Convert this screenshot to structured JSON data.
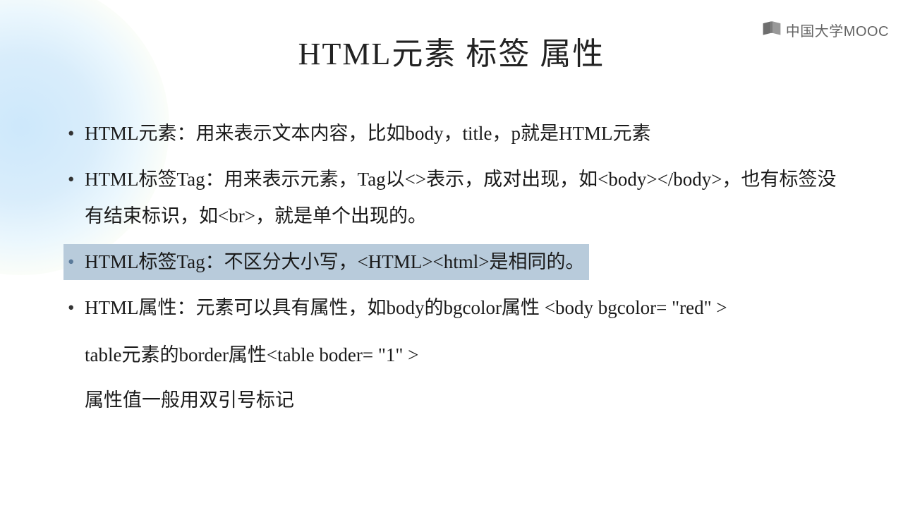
{
  "watermark": {
    "text": "中国大学MOOC"
  },
  "slide": {
    "title": "HTML元素 标签 属性",
    "bullets": [
      {
        "text": "HTML元素：用来表示文本内容，比如body，title，p就是HTML元素",
        "highlighted": false
      },
      {
        "text": "HTML标签Tag：用来表示元素，Tag以<>表示，成对出现，如<body></body>，也有标签没有结束标识，如<br>，就是单个出现的。",
        "highlighted": false
      },
      {
        "text": "HTML标签Tag：不区分大小写，<HTML><html>是相同的。",
        "highlighted": true
      },
      {
        "text": "HTML属性：元素可以具有属性，如body的bgcolor属性  <body bgcolor= \"red\" >",
        "highlighted": false
      }
    ],
    "continuation": [
      "table元素的border属性<table boder= \"1\" >",
      "属性值一般用双引号标记"
    ]
  }
}
